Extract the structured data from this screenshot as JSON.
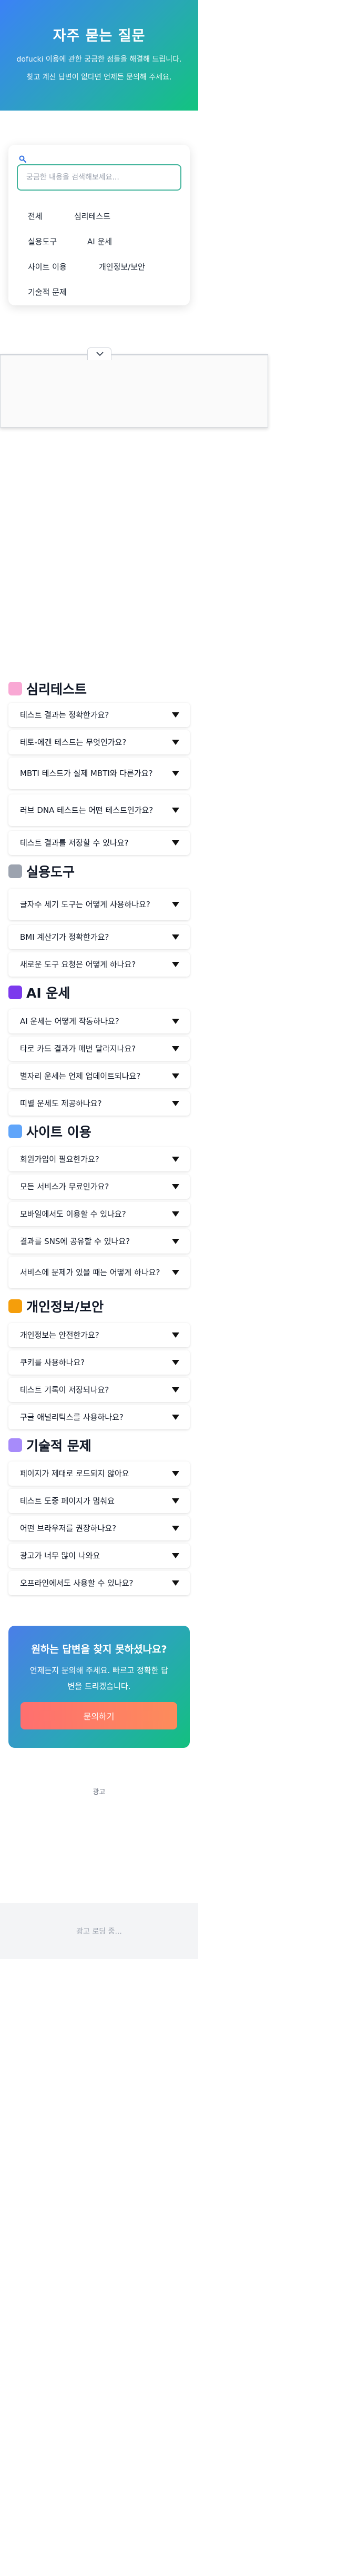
{
  "hero": {
    "title": "자주 묻는 질문",
    "subtitle_line1": "dofucki 이용에 관한 궁금한 점들을 해결해 드립니다.",
    "subtitle_line2": "찾고 계신 답변이 없다면 언제든 문의해 주세요."
  },
  "search": {
    "placeholder": "궁금한 내용을 검색해보세요...",
    "categories": [
      "전체",
      "심리테스트",
      "실용도구",
      "AI 운세",
      "사이트 이용",
      "개인정보/보안",
      "기술적 문제"
    ]
  },
  "sections": [
    {
      "icon": "brain-icon",
      "title": "심리테스트",
      "questions": [
        "테스트 결과는 정확한가요?",
        "테토-에겐 테스트는 무엇인가요?",
        "MBTI 테스트가 실제 MBTI와 다른가요?",
        "러브 DNA 테스트는 어떤 테스트인가요?",
        "테스트 결과를 저장할 수 있나요?"
      ]
    },
    {
      "icon": "tools-icon",
      "title": "실용도구",
      "questions": [
        "글자수 세기 도구는 어떻게 사용하나요?",
        "BMI 계산기가 정확한가요?",
        "새로운 도구 요청은 어떻게 하나요?"
      ]
    },
    {
      "icon": "crystal-ball-icon",
      "title": "AI 운세",
      "questions": [
        "AI 운세는 어떻게 작동하나요?",
        "타로 카드 결과가 매번 달라지나요?",
        "별자리 운세는 언제 업데이트되나요?",
        "띠별 운세도 제공하나요?"
      ]
    },
    {
      "icon": "book-icon",
      "title": "사이트 이용",
      "questions": [
        "회원가입이 필요한가요?",
        "모든 서비스가 무료인가요?",
        "모바일에서도 이용할 수 있나요?",
        "결과를 SNS에 공유할 수 있나요?",
        "서비스에 문제가 있을 때는 어떻게 하나요?"
      ]
    },
    {
      "icon": "lock-icon",
      "title": "개인정보/보안",
      "questions": [
        "개인정보는 안전한가요?",
        "쿠키를 사용하나요?",
        "테스트 기록이 저장되나요?",
        "구글 애널리틱스를 사용하나요?"
      ]
    },
    {
      "icon": "gear-icon",
      "title": "기술적 문제",
      "questions": [
        "페이지가 제대로 로드되지 않아요",
        "테스트 도중 페이지가 멈춰요",
        "어떤 브라우저를 권장하나요?",
        "광고가 너무 많이 나와요",
        "오프라인에서도 사용할 수 있나요?"
      ]
    }
  ],
  "cta": {
    "title": "원하는 답변을 찾지 못하셨나요?",
    "subtitle_line1": "언제든지 문의해 주세요. 빠르고 정확한 답",
    "subtitle_line2": "변을 드리겠습니다.",
    "button": "문의하기"
  },
  "ad": {
    "label": "광고",
    "loading": "광고 로딩 중..."
  },
  "colors": {
    "accent_green": "#3fb39a",
    "cta_button": "#ff7a66"
  }
}
